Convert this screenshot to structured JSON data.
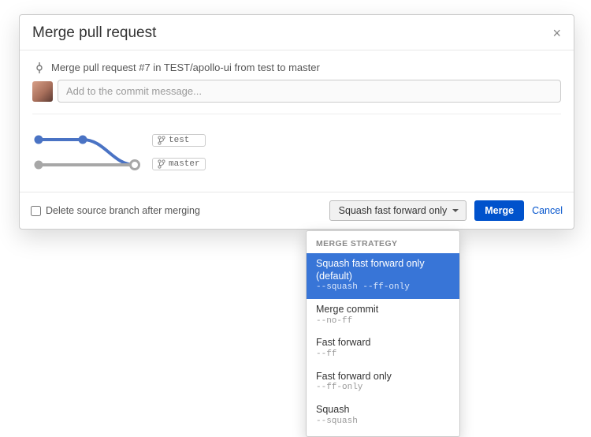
{
  "dialog": {
    "title": "Merge pull request",
    "close": "×",
    "commit_line": "Merge pull request #7 in TEST/apollo-ui from test to master",
    "commit_input_placeholder": "Add to the commit message...",
    "branches": {
      "source": "test",
      "target": "master"
    }
  },
  "footer": {
    "delete_branch_label": "Delete source branch after merging",
    "strategy_button": "Squash fast forward only",
    "merge_label": "Merge",
    "cancel_label": "Cancel"
  },
  "dropdown": {
    "header": "MERGE STRATEGY",
    "items": [
      {
        "label": "Squash fast forward only (default)",
        "flag": "--squash --ff-only",
        "selected": true
      },
      {
        "label": "Merge commit",
        "flag": "--no-ff",
        "selected": false
      },
      {
        "label": "Fast forward",
        "flag": "--ff",
        "selected": false
      },
      {
        "label": "Fast forward only",
        "flag": "--ff-only",
        "selected": false
      },
      {
        "label": "Squash",
        "flag": "--squash",
        "selected": false
      }
    ]
  }
}
